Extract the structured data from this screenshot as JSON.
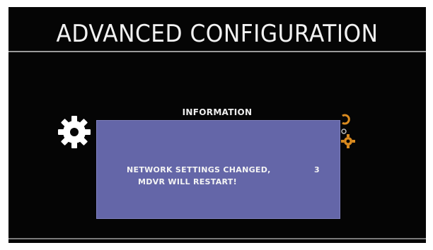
{
  "screen": {
    "title": "ADVANCED CONFIGURATION"
  },
  "dialog": {
    "header": "INFORMATION",
    "message_line1": "NETWORK SETTINGS CHANGED,",
    "message_line2": "MDVR WILL RESTART!",
    "countdown": "3"
  },
  "icons": {
    "left": "gear-icon",
    "right": "network-gears-icon"
  },
  "colors": {
    "background": "#050505",
    "dialog": "#6466a8",
    "accent_orange": "#d98a1f"
  }
}
